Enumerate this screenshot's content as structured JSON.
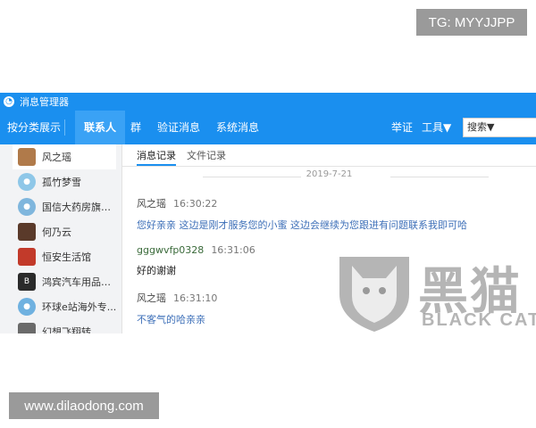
{
  "overlays": {
    "tg_badge": "TG: MYYJJPP",
    "url_badge": "www.dilaodong.com",
    "watermark_title": "黑猫",
    "watermark_sub": "BLACK CAT"
  },
  "titlebar": {
    "title": "消息管理器"
  },
  "toolbar": {
    "classify": "按分类展示",
    "tabs": [
      "联系人",
      "群",
      "验证消息",
      "系统消息"
    ],
    "active_tab": 0,
    "cert": "举证",
    "tools": "工具▼",
    "search": "搜索▼"
  },
  "sidebar": {
    "contacts": [
      {
        "name": "风之瑶",
        "avatar_color": "#b07a4a",
        "selected": true
      },
      {
        "name": "孤竹梦雪",
        "avatar_color": "#8ec7e8",
        "round": true
      },
      {
        "name": "国信大药房旗舰...",
        "avatar_color": "#7fb6dd",
        "round": true
      },
      {
        "name": "何乃云",
        "avatar_color": "#5a3a2a"
      },
      {
        "name": "恒安生活馆",
        "avatar_color": "#c23a2a"
      },
      {
        "name": "鸿宾汽车用品专...",
        "avatar_color": "#2a2a2a"
      },
      {
        "name": "环球e站海外专...",
        "avatar_color": "#6fb1e0",
        "round": true
      },
      {
        "name": "幻想飞翔转",
        "avatar_color": "#6a6a6a"
      }
    ]
  },
  "main": {
    "tabs": [
      "消息记录",
      "文件记录"
    ],
    "date": "2019-7-21",
    "messages": [
      {
        "sender": "风之瑶",
        "time": "16:30:22",
        "body": "您好亲亲 这边是刚才服务您的小蜜 这边会继续为您跟进有问题联系我即可哈"
      },
      {
        "sender": "gggwvfp0328",
        "time": "16:31:06",
        "body": "好的谢谢"
      },
      {
        "sender": "风之瑶",
        "time": "16:31:10",
        "body": "不客气的哈亲亲"
      }
    ]
  },
  "colors": {
    "accent": "#1a8fef",
    "message_blue": "#3d6fb8"
  }
}
